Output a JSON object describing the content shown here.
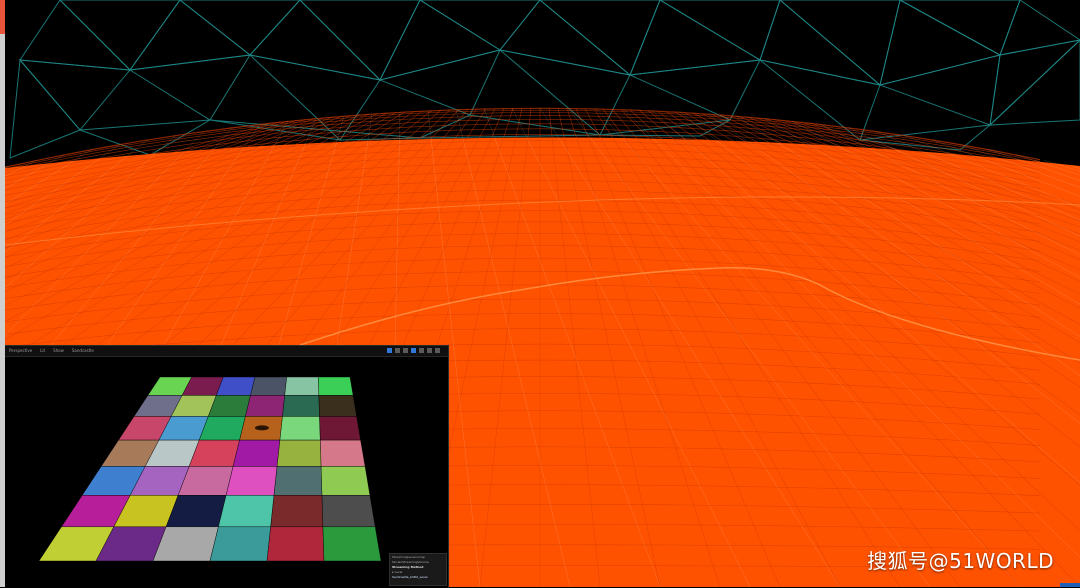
{
  "colors": {
    "terrain_fill": "#ff5200",
    "terrain_line": "#d63b00",
    "sky": "#000000",
    "sky_mesh": "#1f8a8a",
    "side_strip": "#cfcfcf",
    "side_accent": "#e8553a"
  },
  "viewport": {
    "toolbar_items": [
      "Perspective",
      "Lit",
      "Show",
      "Sandcastle"
    ],
    "icons": [
      "translate-icon",
      "rotate-icon",
      "scale-icon",
      "grid-icon",
      "angle-icon",
      "camera-speed-icon",
      "maximize-icon"
    ],
    "tile_colors": [
      "#68d452",
      "#7a1c4d",
      "#3f4fc8",
      "#4b5366",
      "#86c4a4",
      "#3bcf58",
      "#6f6f8c",
      "#a2c25a",
      "#2b7c3a",
      "#8d2474",
      "#2a6a52",
      "#3a2e1c",
      "#c8466a",
      "#4a9cd0",
      "#1faa60",
      "#b6621c",
      "#7ad77c",
      "#6e1836",
      "#a77a5a",
      "#b9c7c6",
      "#d6415c",
      "#a11aa6",
      "#97b23e",
      "#d5788a",
      "#3f7fcf",
      "#a564bf",
      "#c86aa0",
      "#de4fc0",
      "#4f6f70",
      "#8fcb53",
      "#b61e9a",
      "#c9c322",
      "#141c44",
      "#4ec5a8",
      "#7a2a2a",
      "#4d4d4d",
      "#c0d034",
      "#6c2a88",
      "#a8a8a8",
      "#3b9b9a",
      "#b0263a",
      "#2a9a3c"
    ]
  },
  "outliner": {
    "lines": [
      "StreamingLevel.umap",
      "TerrainStreamingVolume",
      "Streaming Method",
      "▸ Level",
      "  Sandcastle_LOD0_Level"
    ]
  },
  "watermark": {
    "text": "搜狐号@51WORLD"
  }
}
